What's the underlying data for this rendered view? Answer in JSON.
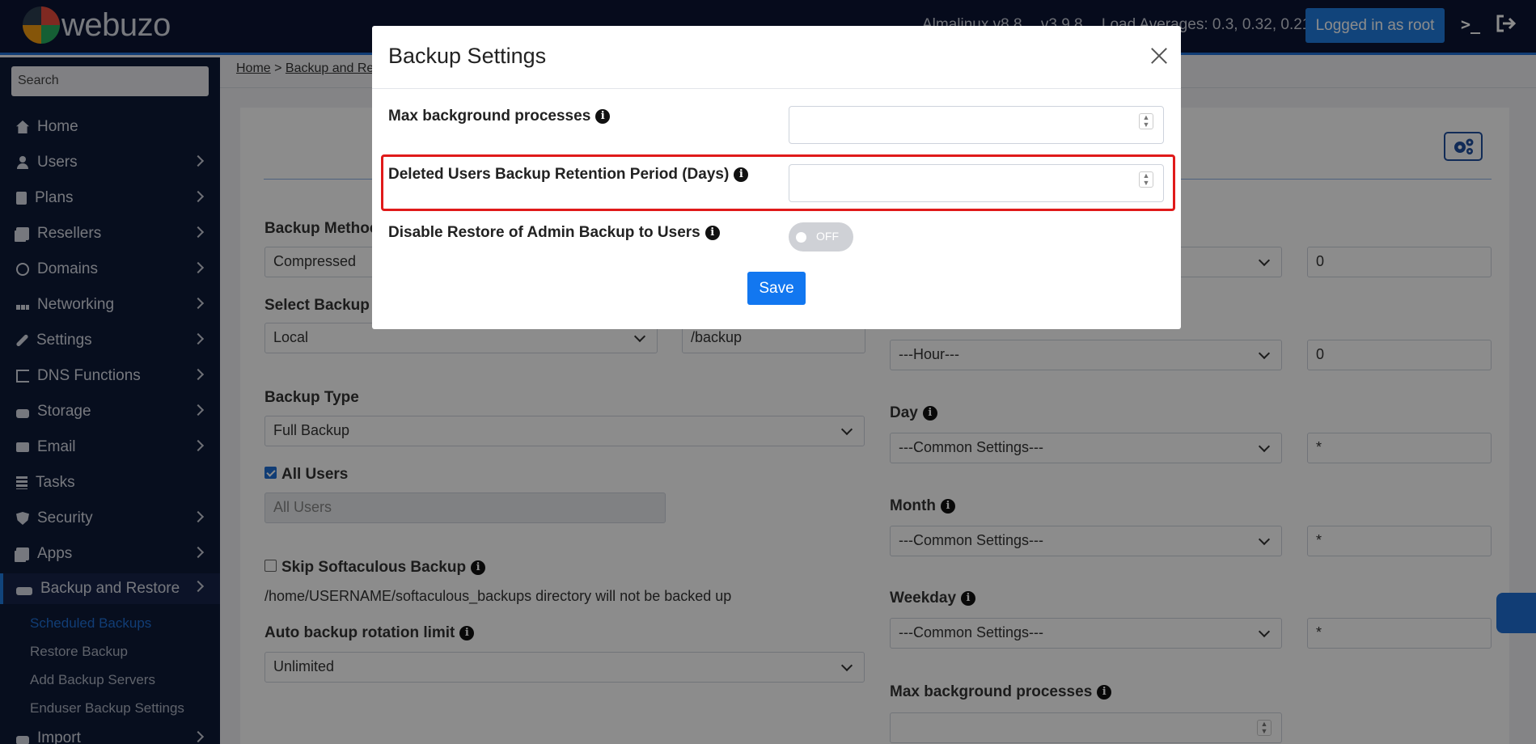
{
  "header": {
    "logo_text": "webuzo",
    "os": "Almalinux v8.8",
    "version": "v3.9.8",
    "load": "Load Averages: 0.3, 0.32, 0.21",
    "logged_in": "Logged in as root"
  },
  "sidebar": {
    "search_placeholder": "Search",
    "items": [
      {
        "label": "Home",
        "icon": "home-icon"
      },
      {
        "label": "Users",
        "icon": "user-icon"
      },
      {
        "label": "Plans",
        "icon": "plans-icon"
      },
      {
        "label": "Resellers",
        "icon": "resellers-icon"
      },
      {
        "label": "Domains",
        "icon": "globe-icon"
      },
      {
        "label": "Networking",
        "icon": "network-icon"
      },
      {
        "label": "Settings",
        "icon": "wrench-icon"
      },
      {
        "label": "DNS Functions",
        "icon": "dns-icon"
      },
      {
        "label": "Storage",
        "icon": "storage-icon"
      },
      {
        "label": "Email",
        "icon": "mail-icon"
      },
      {
        "label": "Tasks",
        "icon": "tasks-icon"
      },
      {
        "label": "Security",
        "icon": "shield-icon"
      },
      {
        "label": "Apps",
        "icon": "apps-icon"
      },
      {
        "label": "Backup and Restore",
        "icon": "backup-icon"
      },
      {
        "label": "Import",
        "icon": "import-icon"
      }
    ],
    "subitems": [
      "Scheduled Backups",
      "Restore Backup",
      "Add Backup Servers",
      "Enduser Backup Settings"
    ]
  },
  "breadcrumb": {
    "home": "Home",
    "sep": " > ",
    "section": "Backup and Re"
  },
  "page": {
    "backup_method_label": "Backup Methoc",
    "backup_method_value": "Compressed",
    "select_backup_label": "Select Backup S",
    "backup_server_value": "Local",
    "backup_path_value": "/backup",
    "backup_type_label": "Backup Type",
    "backup_type_value": "Full Backup",
    "all_users_label": "All Users",
    "all_users_placeholder": "All Users",
    "skip_softaculous_label": "Skip Softaculous Backup",
    "skip_note": "/home/USERNAME/softaculous_backups directory will not be backed up",
    "rotation_label": "Auto backup rotation limit",
    "rotation_value": "Unlimited",
    "minute_value": "0",
    "hour_select": "---Hour---",
    "hour_value": "0",
    "day_label": "Day",
    "day_select": "---Common Settings---",
    "day_value": "*",
    "month_label": "Month",
    "month_select": "---Common Settings---",
    "month_value": "*",
    "weekday_label": "Weekday",
    "weekday_select": "---Common Settings---",
    "weekday_value": "*",
    "max_bg_label": "Max background processes"
  },
  "modal": {
    "title": "Backup Settings",
    "max_bg_label": "Max background processes",
    "retention_label": "Deleted Users Backup Retention Period (Days)",
    "disable_restore_label": "Disable Restore of Admin Backup to Users",
    "toggle_state": "OFF",
    "save_label": "Save",
    "info_glyph": "i"
  }
}
